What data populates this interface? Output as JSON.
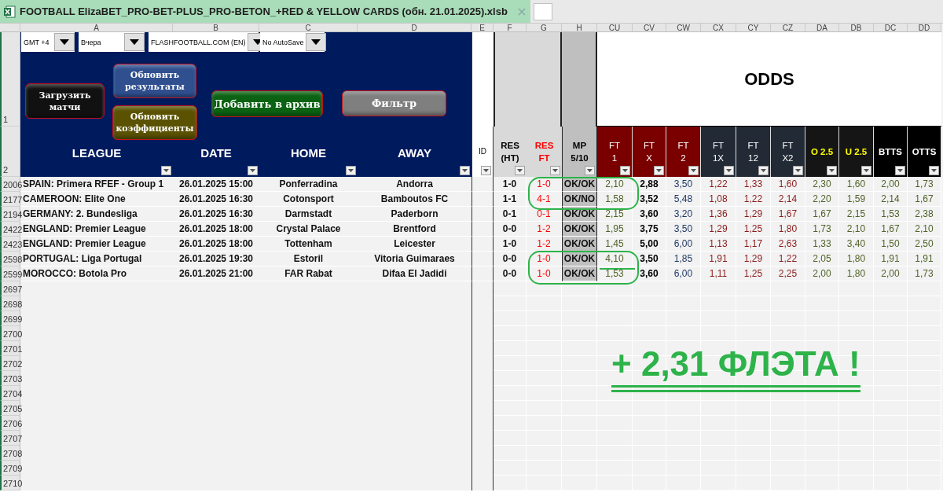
{
  "window": {
    "title": "FOOTBALL ElizaBET_PRO-BET-PLUS_PRO-BETON_+RED & YELLOW CARDS (обн. 21.01.2025).xlsb"
  },
  "column_letters": [
    "A",
    "B",
    "C",
    "D",
    "E",
    "F",
    "G",
    "H",
    "CU",
    "CV",
    "CW",
    "CX",
    "CY",
    "CZ",
    "DA",
    "DB",
    "DC",
    "DD"
  ],
  "controls": {
    "dropdowns": [
      {
        "value": "GMT +4"
      },
      {
        "value": "Вчера"
      },
      {
        "value": "FLASHFOOTBALL.COM (EN)"
      },
      {
        "value": "No AutoSave"
      }
    ],
    "buttons": [
      {
        "label": "Загрузить\nматчи",
        "color": "#111111"
      },
      {
        "label": "Обновить\nрезультаты",
        "color": "#2f4f8f"
      },
      {
        "label": "Обновить\nкоэффициенты",
        "color": "#5a5200"
      },
      {
        "label": "Добавить в архив",
        "color": "#0b6212"
      },
      {
        "label": "Фильтр",
        "color": "#7f7f7f"
      }
    ]
  },
  "header_rows": [
    {
      "row_number": "1",
      "odds_title": "ODDS"
    },
    {
      "row_number": "2"
    }
  ],
  "columns": [
    {
      "label": "LEAGUE",
      "kind": "main"
    },
    {
      "label": "DATE",
      "kind": "main"
    },
    {
      "label": "HOME",
      "kind": "main"
    },
    {
      "label": "AWAY",
      "kind": "main"
    },
    {
      "label": "ID",
      "kind": "id"
    },
    {
      "label": "RES\n(HT)",
      "kind": "result"
    },
    {
      "label": "RES\nFT",
      "kind": "result_ft"
    },
    {
      "label": "MP\n5/10",
      "kind": "mp"
    },
    {
      "label": "FT\n1",
      "kind": "ft_outcome"
    },
    {
      "label": "FT\nX",
      "kind": "ft_outcome"
    },
    {
      "label": "FT\n2",
      "kind": "ft_outcome"
    },
    {
      "label": "FT\n1X",
      "kind": "ft_double"
    },
    {
      "label": "FT\n12",
      "kind": "ft_double"
    },
    {
      "label": "FT\nX2",
      "kind": "ft_double"
    },
    {
      "label": "O 2.5",
      "kind": "total"
    },
    {
      "label": "U 2.5",
      "kind": "total"
    },
    {
      "label": "BTTS",
      "kind": "btts"
    },
    {
      "label": "OTTS",
      "kind": "btts"
    }
  ],
  "rows": [
    {
      "row_number": "2006",
      "league": "SPAIN: Primera RFEF - Group 1",
      "date": "26.01.2025 15:00",
      "home": "Ponferradina",
      "away": "Andorra",
      "res_ht": "1-0",
      "res_ft": "1-0",
      "mp": "OK/OK",
      "odds": [
        "2,10",
        "2,88",
        "3,50",
        "1,22",
        "1,33",
        "1,60",
        "2,30",
        "1,60",
        "2,00",
        "1,73"
      ]
    },
    {
      "row_number": "2177",
      "league": "CAMEROON: Elite One",
      "date": "26.01.2025 16:30",
      "home": "Cotonsport",
      "away": "Bamboutos FC",
      "res_ht": "1-1",
      "res_ft": "4-1",
      "mp": "OK/NO",
      "odds": [
        "1,58",
        "3,52",
        "5,48",
        "1,08",
        "1,22",
        "2,14",
        "2,20",
        "1,59",
        "2,14",
        "1,67"
      ]
    },
    {
      "row_number": "2194",
      "league": "GERMANY: 2. Bundesliga",
      "date": "26.01.2025 16:30",
      "home": "Darmstadt",
      "away": "Paderborn",
      "res_ht": "0-1",
      "res_ft": "0-1",
      "mp": "OK/OK",
      "odds": [
        "2,15",
        "3,60",
        "3,20",
        "1,36",
        "1,29",
        "1,67",
        "1,67",
        "2,15",
        "1,53",
        "2,38"
      ]
    },
    {
      "row_number": "2422",
      "league": "ENGLAND: Premier League",
      "date": "26.01.2025 18:00",
      "home": "Crystal Palace",
      "away": "Brentford",
      "res_ht": "0-0",
      "res_ft": "1-2",
      "mp": "OK/OK",
      "odds": [
        "1,95",
        "3,75",
        "3,50",
        "1,29",
        "1,25",
        "1,80",
        "1,73",
        "2,10",
        "1,67",
        "2,10"
      ]
    },
    {
      "row_number": "2423",
      "league": "ENGLAND: Premier League",
      "date": "26.01.2025 18:00",
      "home": "Tottenham",
      "away": "Leicester",
      "res_ht": "1-0",
      "res_ft": "1-2",
      "mp": "OK/OK",
      "odds": [
        "1,45",
        "5,00",
        "6,00",
        "1,13",
        "1,17",
        "2,63",
        "1,33",
        "3,40",
        "1,50",
        "2,50"
      ]
    },
    {
      "row_number": "2598",
      "league": "PORTUGAL: Liga Portugal",
      "date": "26.01.2025 19:30",
      "home": "Estoril",
      "away": "Vitoria Guimaraes",
      "res_ht": "0-0",
      "res_ft": "1-0",
      "mp": "OK/OK",
      "odds": [
        "4,10",
        "3,50",
        "1,85",
        "1,91",
        "1,29",
        "1,22",
        "2,05",
        "1,80",
        "1,91",
        "1,91"
      ]
    },
    {
      "row_number": "2599",
      "league": "MOROCCO: Botola Pro",
      "date": "26.01.2025 21:00",
      "home": "FAR Rabat",
      "away": "Difaa El Jadidi",
      "res_ht": "0-0",
      "res_ft": "1-0",
      "mp": "OK/OK",
      "odds": [
        "1,53",
        "3,60",
        "6,00",
        "1,11",
        "1,25",
        "2,25",
        "2,00",
        "1,80",
        "2,00",
        "1,73"
      ]
    }
  ],
  "empty_row_numbers": [
    "2697",
    "2698",
    "2699",
    "2700",
    "2701",
    "2702",
    "2703",
    "2704",
    "2705",
    "2706",
    "2707",
    "2708",
    "2709",
    "2710"
  ],
  "annotation": {
    "text": "+ 2,31 ФЛЭТА !"
  }
}
